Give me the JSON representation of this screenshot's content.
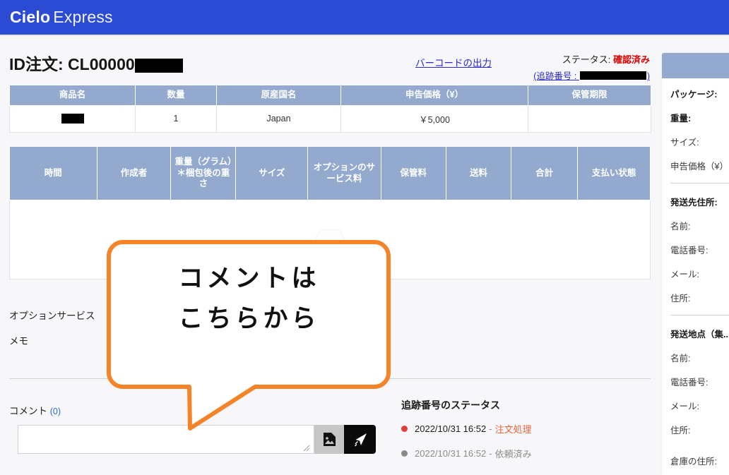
{
  "brand": {
    "part1": "Cielo",
    "part2": "Express"
  },
  "header": {
    "order_id_label": "ID注文: CL00000",
    "barcode_link": "バーコードの出力",
    "status_label": "ステータス:",
    "status_value": "確認済み",
    "tracking_prefix": "(追跡番号 : ",
    "tracking_suffix": ")"
  },
  "item_table": {
    "columns": [
      "商品名",
      "数量",
      "原産国名",
      "申告価格（¥）",
      "保管期限"
    ],
    "rows": [
      {
        "name": "",
        "qty": "1",
        "origin": "Japan",
        "price": "￥5,000",
        "storage": ""
      }
    ]
  },
  "shipment_table": {
    "columns": [
      "時間",
      "作成者",
      "重量（グラム）＊梱包後の重さ",
      "サイズ",
      "オプションのサービス料",
      "保管料",
      "送料",
      "合計",
      "支払い状態"
    ],
    "rows": [],
    "empty_icon": "empty-tray-icon"
  },
  "sections": {
    "option_service": "オプションサービス",
    "memo": "メモ",
    "comment_label": "コメント",
    "comment_count": "(0)"
  },
  "comment": {
    "value": "",
    "placeholder": "",
    "attach_icon": "image-attachment-icon",
    "send_icon": "send-paper-plane-icon"
  },
  "tracking_status": {
    "title": "追跡番号のステータス",
    "items": [
      {
        "time": "2022/10/31 16:52",
        "sep": "-",
        "state": "注文処理",
        "active": true
      },
      {
        "time": "2022/10/31 16:52",
        "sep": "-",
        "state": "依頼済み",
        "active": false
      }
    ]
  },
  "sidebar": {
    "package_group": [
      "パッケージ:",
      "重量:",
      "サイズ:",
      "申告価格（¥）"
    ],
    "ship_to_group": [
      "発送先住所:",
      "名前:",
      "電話番号:",
      "メール:",
      "住所:"
    ],
    "ship_from_group": [
      "発送地点（集...",
      "名前:",
      "電話番号:",
      "メール:",
      "住所:"
    ],
    "warehouse": "倉庫の住所:"
  },
  "annotation": {
    "line1": "コメントは",
    "line2": "こちらから",
    "color": "#F58428"
  },
  "colors": {
    "brand_blue": "#2B4BD4",
    "table_header": "#93AACE",
    "status_red": "#E00000",
    "price_red": "#D03A2A",
    "link_blue": "#2A2AD0",
    "accent_orange": "#F58428"
  }
}
